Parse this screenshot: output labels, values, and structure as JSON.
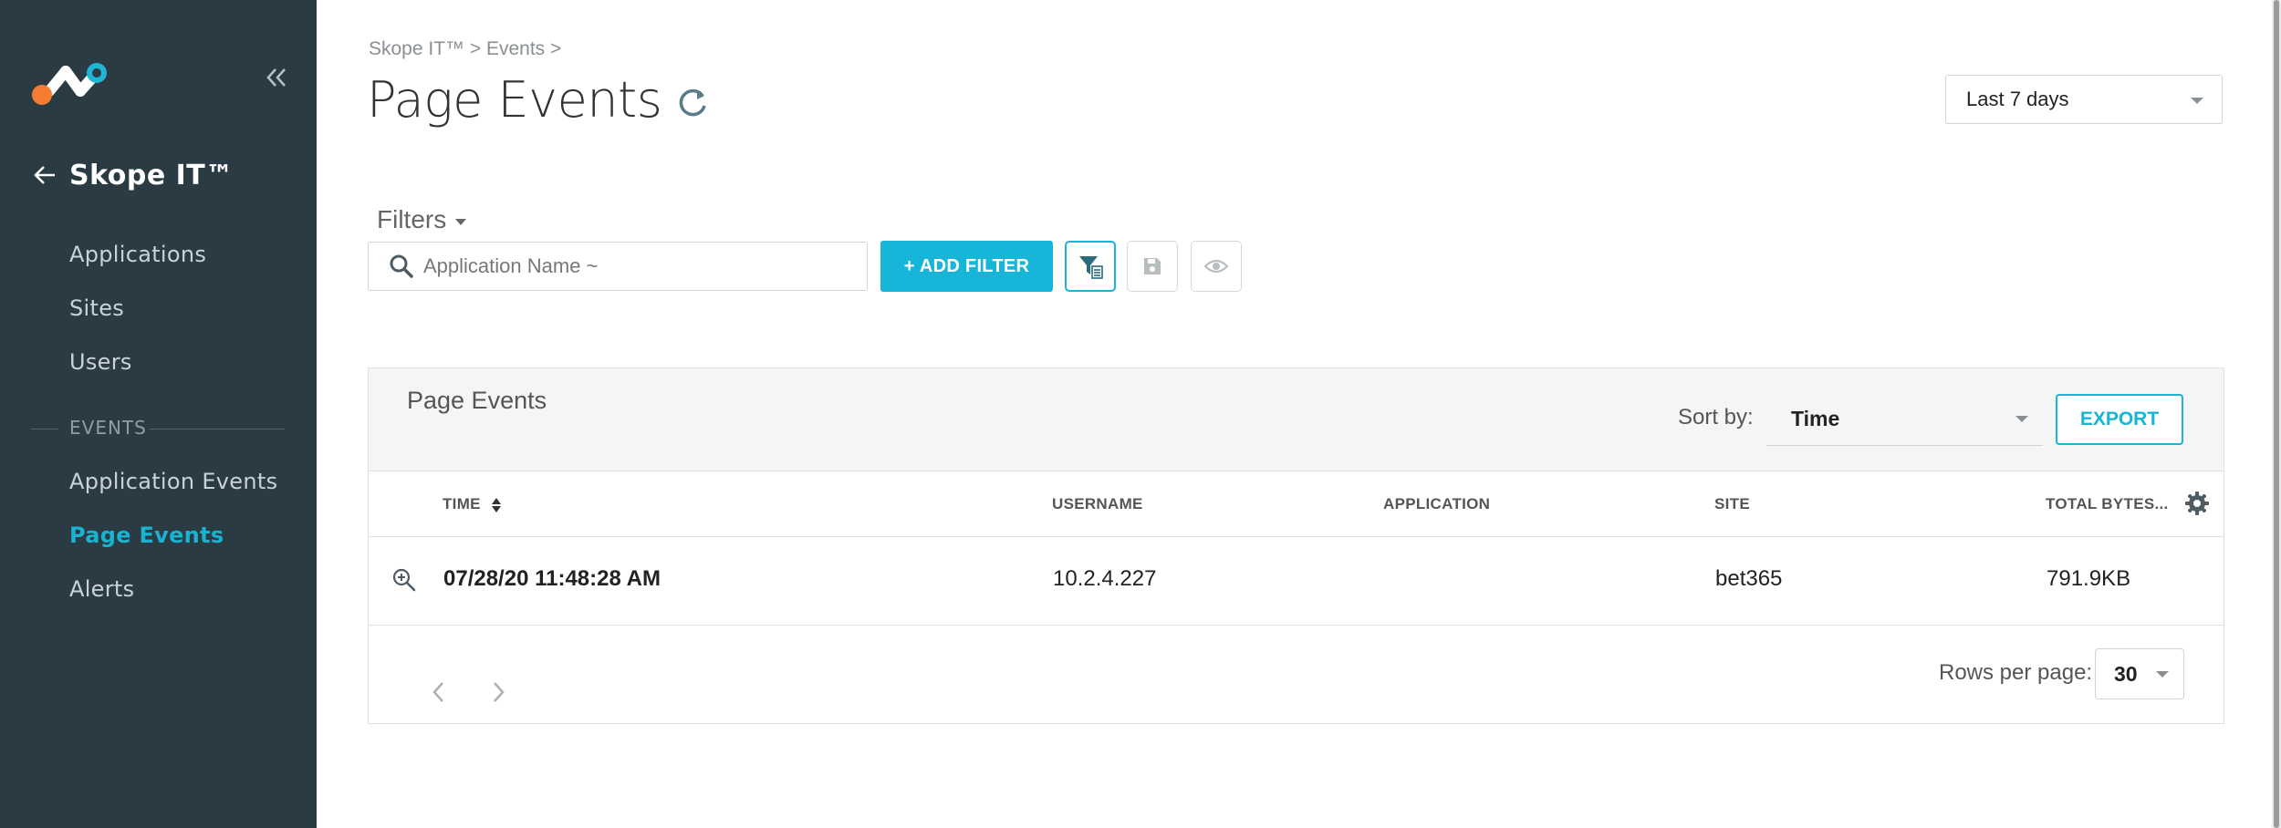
{
  "sidebar": {
    "collapse_icon": "double-chevron-left",
    "back_icon": "arrow-left",
    "app_title": "Skope IT™",
    "items": [
      {
        "label": "Applications",
        "active": false
      },
      {
        "label": "Sites",
        "active": false
      },
      {
        "label": "Users",
        "active": false
      }
    ],
    "section_label": "EVENTS",
    "event_items": [
      {
        "label": "Application Events",
        "active": false
      },
      {
        "label": "Page Events",
        "active": true
      },
      {
        "label": "Alerts",
        "active": false
      }
    ]
  },
  "header": {
    "breadcrumb": "Skope IT™ > Events >",
    "title": "Page Events",
    "refresh_icon": "refresh",
    "date_range": "Last 7 days"
  },
  "filters": {
    "label": "Filters",
    "search_placeholder": "Application Name ~",
    "search_value": "",
    "add_filter_label": "+ ADD FILTER",
    "icons": [
      "filter-list",
      "save",
      "eye"
    ]
  },
  "panel": {
    "title": "Page Events",
    "sort_by_label": "Sort by:",
    "sort_by_value": "Time",
    "export_label": "EXPORT",
    "columns": [
      "TIME",
      "USERNAME",
      "APPLICATION",
      "SITE",
      "TOTAL BYTES..."
    ],
    "rows": [
      {
        "time": "07/28/20 11:48:28 AM",
        "username": "10.2.4.227",
        "application": "",
        "site": "bet365",
        "total_bytes": "791.9KB"
      }
    ],
    "rows_per_page_label": "Rows per page:",
    "rows_per_page_value": "30"
  },
  "colors": {
    "sidebar_bg": "#2b3b44",
    "accent": "#17b6d8",
    "active_nav": "#19b3d1"
  }
}
